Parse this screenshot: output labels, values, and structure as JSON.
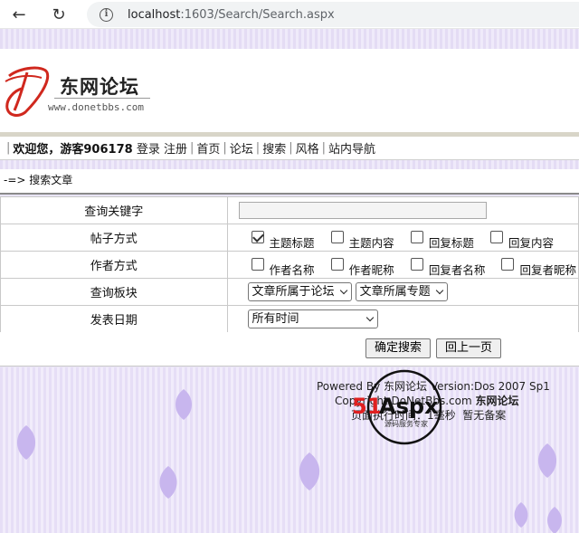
{
  "browser": {
    "url_host": "localhost",
    "url_rest": ":1603/Search/Search.aspx"
  },
  "header": {
    "site_name": "东网论坛",
    "site_url": "www.donetbbs.com"
  },
  "navbar": {
    "welcome": "欢迎您，游客906178",
    "links": [
      "登录",
      "注册",
      "首页",
      "论坛",
      "搜索",
      "风格",
      "站内导航"
    ]
  },
  "breadcrumb": "-=> 搜索文章",
  "form": {
    "rows": [
      {
        "label": "查询关键字"
      },
      {
        "label": "帖子方式"
      },
      {
        "label": "作者方式"
      },
      {
        "label": "查询板块"
      },
      {
        "label": "发表日期"
      }
    ],
    "post_options": [
      {
        "label": "主题标题",
        "checked": true
      },
      {
        "label": "主题内容",
        "checked": false
      },
      {
        "label": "回复标题",
        "checked": false
      },
      {
        "label": "回复内容",
        "checked": false
      }
    ],
    "author_options": [
      {
        "label": "作者名称",
        "checked": false
      },
      {
        "label": "作者昵称",
        "checked": false
      },
      {
        "label": "回复者名称",
        "checked": false
      },
      {
        "label": "回复者昵称",
        "checked": false
      }
    ],
    "board_select": "文章所属于论坛",
    "topic_select": "文章所属专题",
    "date_select": "所有时间",
    "search_button": "确定搜索",
    "back_button": "回上一页"
  },
  "footer": {
    "powered_prefix": "Powered By ",
    "powered_name": "东网论坛",
    "version": " Version:Dos 2007 Sp1",
    "copyright_prefix": "Copyright ",
    "copyright_site": "DoNetBbs.com",
    "copyright_name": "东网论坛",
    "exec_time": "页面执行时间：1毫秒",
    "icp": "暂无备案",
    "watermark_text": "51Aspx",
    "watermark_sub": "源码服务专家"
  },
  "colors": {
    "page_bg": "#e9e4f5",
    "logo_red": "#d0281e",
    "leaf": "#c8b6ee"
  }
}
